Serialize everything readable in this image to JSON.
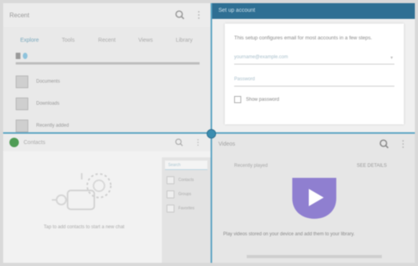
{
  "top_left": {
    "title": "Recent",
    "tabs": [
      {
        "label": "Explore"
      },
      {
        "label": "Tools"
      },
      {
        "label": "Recent"
      },
      {
        "label": "Views"
      },
      {
        "label": "Library"
      }
    ],
    "items": [
      {
        "label": "Documents"
      },
      {
        "label": "Downloads"
      },
      {
        "label": "Recently added"
      }
    ]
  },
  "top_right": {
    "title": "Set up account",
    "message": "This setup configures email for most accounts in a few steps.",
    "fields": [
      {
        "value": "yourname@example.com"
      },
      {
        "value": "Password"
      }
    ],
    "checkbox_label": "Show password"
  },
  "bottom_left": {
    "title": "Contacts",
    "empty_text": "Tap to add contacts to start a new chat",
    "search_placeholder": "Search",
    "side_items": [
      {
        "label": "Contacts"
      },
      {
        "label": "Groups"
      },
      {
        "label": "Favorites"
      }
    ]
  },
  "bottom_right": {
    "title": "Videos",
    "left_label": "Recently played",
    "right_label": "SEE DETAILS",
    "body_text": "Play videos stored on your device and add them to your library."
  },
  "colors": {
    "divider": "#5aa3c2",
    "accent": "#2e6f93",
    "logo": "#8f7fd0"
  }
}
